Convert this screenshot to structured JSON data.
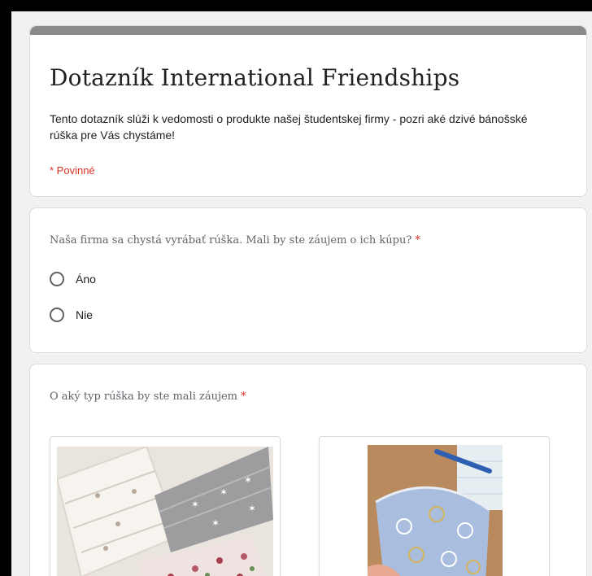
{
  "form": {
    "title": "Dotazník International Friendships",
    "description": "Tento dotazník slúži k vedomosti o produkte našej študentskej firmy - pozri aké dzivé bánošské rúška pre Vás chystáme!",
    "required_note": "* Povinné",
    "accent_color": "#8a8a8a"
  },
  "question1": {
    "title": "Naša firma sa chystá vyrábať rúška. Mali by ste záujem o ich kúpu?",
    "required_mark": "*",
    "options": [
      {
        "label": "Áno",
        "selected": false
      },
      {
        "label": "Nie",
        "selected": false
      }
    ]
  },
  "question2": {
    "title": "O aký typ rúška by ste mali záujem",
    "required_mark": "*",
    "images": [
      {
        "icon": "fabric-masks-photo"
      },
      {
        "icon": "shaped-mask-photo"
      }
    ]
  }
}
